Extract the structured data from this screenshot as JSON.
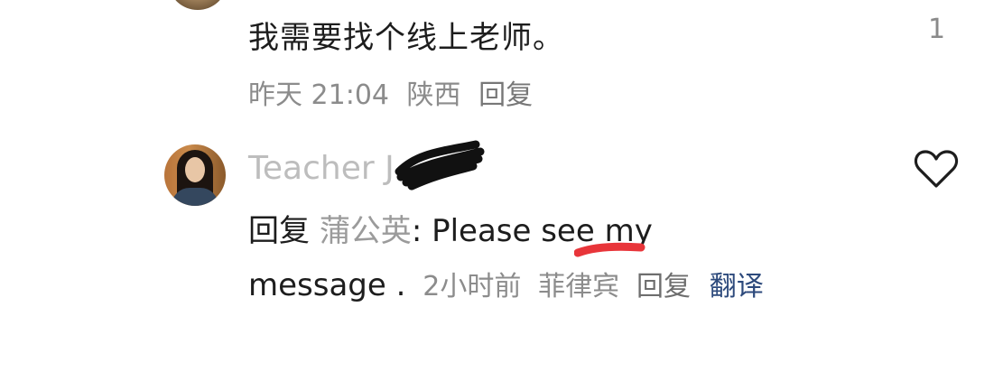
{
  "prev_comment": {
    "text": "我需要找个线上老师。",
    "like_count": "1",
    "time": "昨天 21:04",
    "location": "陕西",
    "reply_label": "回复"
  },
  "reply_comment": {
    "username": "Teacher J",
    "reply_prefix": "回复",
    "mention": "蒲公英",
    "text_part1": ": Please see my",
    "text_part2": "message .",
    "time": "2小时前",
    "location": "菲律宾",
    "reply_label": "回复",
    "translate_label": "翻译"
  },
  "colors": {
    "text": "#1d1d1d",
    "meta": "#8c8c8c",
    "username": "#bdbdbd",
    "translate": "#2d4a7c",
    "annotation_red": "#e8353a"
  },
  "icons": {
    "like": "heart-outline-icon"
  }
}
